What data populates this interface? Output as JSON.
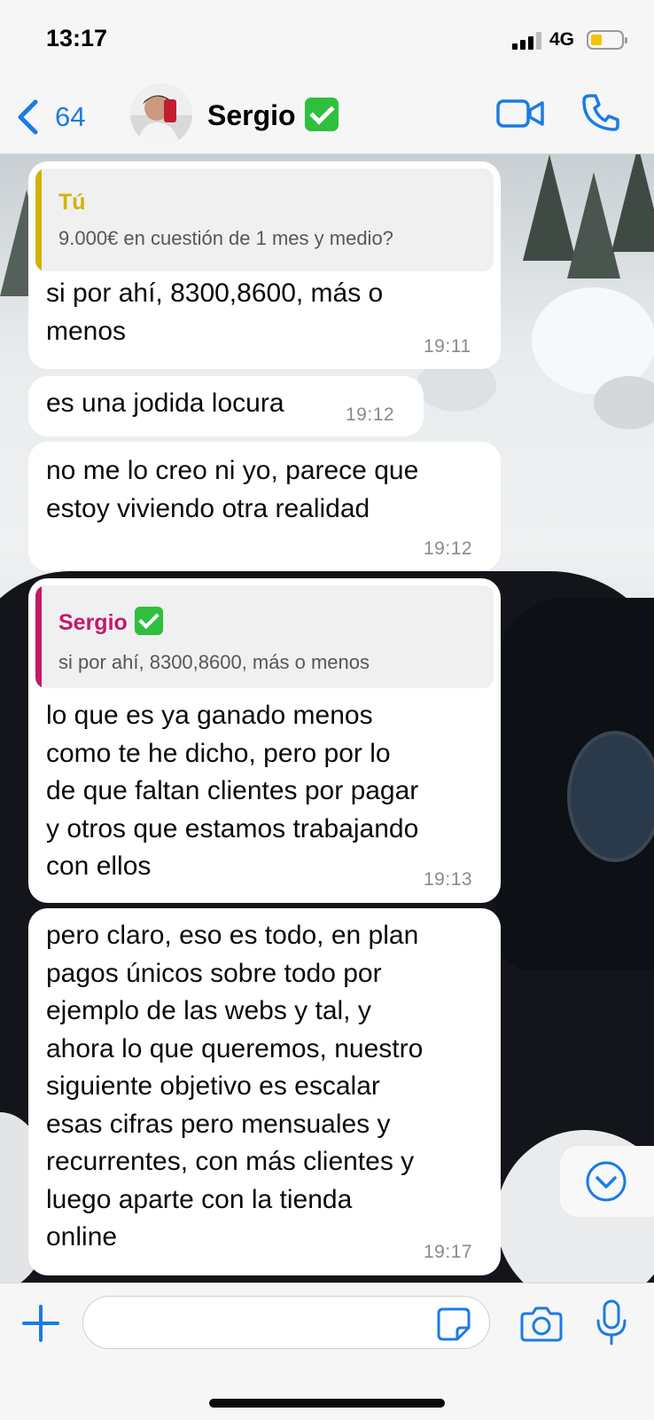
{
  "status_bar": {
    "time": "13:17",
    "network": "4G",
    "battery_color": "#f5c400"
  },
  "header": {
    "back_count": "64",
    "contact_name": "Sergio",
    "verified_icon": "green-check-icon",
    "accent": "#1b7be5"
  },
  "messages": [
    {
      "reply": {
        "name": "Tú",
        "text": "9.000€ en cuestión de 1 mes y medio?",
        "color": "#d1b300"
      },
      "lines": [
        "si por ahí, 8300,8600, más o",
        "menos"
      ],
      "time": "19:11"
    },
    {
      "lines": [
        "es una jodida locura"
      ],
      "time": "19:12"
    },
    {
      "lines": [
        "no me lo creo ni yo, parece que",
        "estoy viviendo otra realidad"
      ],
      "time": "19:12"
    },
    {
      "reply": {
        "name": "Sergio",
        "text": "si por ahí, 8300,8600, más o menos",
        "color": "#c4196b"
      },
      "lines": [
        "lo que es ya ganado menos",
        "como te he dicho, pero por lo",
        "de que faltan clientes por pagar",
        "y otros que estamos trabajando",
        "con ellos"
      ],
      "time": "19:13"
    },
    {
      "lines": [
        "pero claro, eso es todo, en plan",
        "pagos únicos sobre todo por",
        "ejemplo de las webs y tal, y",
        "ahora lo que queremos, nuestro",
        "siguiente objetivo es escalar",
        "esas cifras pero mensuales y",
        "recurrentes, con más clientes y",
        "luego aparte con la tienda",
        "online"
      ],
      "time": "19:17"
    }
  ],
  "composer": {
    "placeholder": ""
  }
}
